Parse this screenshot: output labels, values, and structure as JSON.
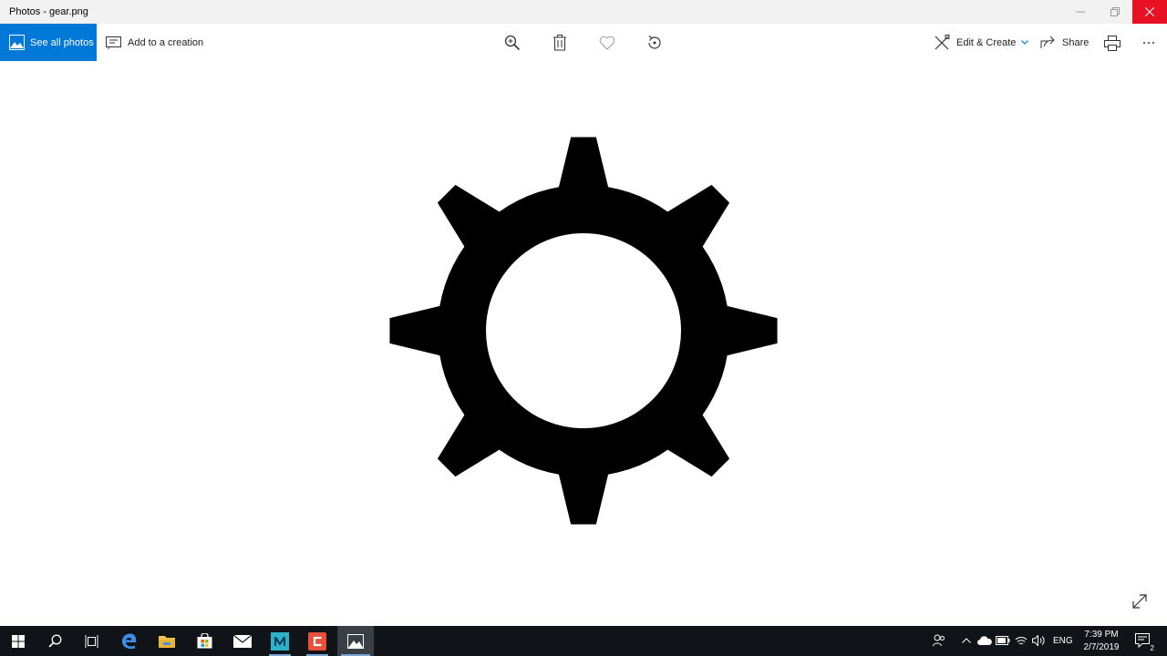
{
  "window": {
    "title": "Photos - gear.png",
    "controls": {
      "minimize": "minimize-icon",
      "restore": "restore-icon",
      "close": "close-icon"
    }
  },
  "toolbar": {
    "see_all_label": "See all photos",
    "add_creation_label": "Add to a creation",
    "edit_create_label": "Edit & Create",
    "share_label": "Share",
    "icons": [
      "zoom-in-icon",
      "delete-icon",
      "favorite-icon",
      "rotate-icon",
      "print-icon",
      "more-icon"
    ]
  },
  "viewer": {
    "image_subject": "gear-icon",
    "expand_icon": "expand-icon"
  },
  "taskbar": {
    "apps": [
      "start-icon",
      "search-icon",
      "task-view-icon",
      "edge-icon",
      "file-explorer-icon",
      "store-icon",
      "mail-icon",
      "m-app-icon",
      "c-app-icon",
      "photos-icon"
    ],
    "tray": {
      "language": "ENG",
      "time": "7:39 PM",
      "date": "2/7/2019",
      "notification_count": "2"
    }
  },
  "colors": {
    "accent": "#0078d7",
    "close_hover": "#e81123",
    "taskbar": "#101418",
    "titlebar": "#f2f2f2"
  }
}
